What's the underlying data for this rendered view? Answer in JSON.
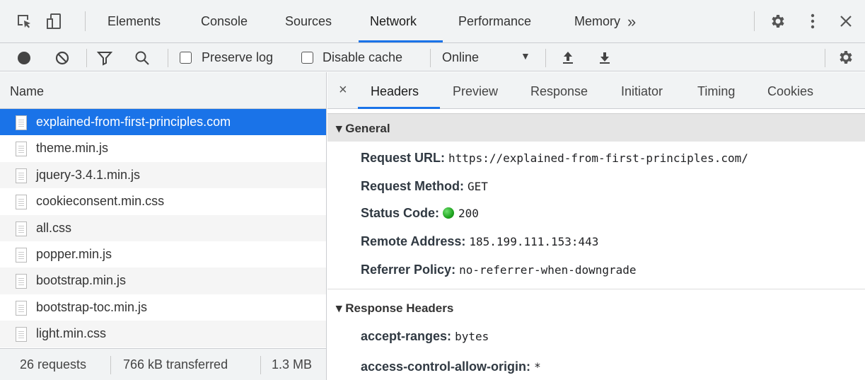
{
  "main_tabs": [
    {
      "label": "Elements"
    },
    {
      "label": "Console"
    },
    {
      "label": "Sources"
    },
    {
      "label": "Network",
      "active": true
    },
    {
      "label": "Performance"
    },
    {
      "label": "Memory"
    }
  ],
  "more_tabs": "»",
  "toolbar": {
    "preserve_log": "Preserve log",
    "disable_cache": "Disable cache",
    "throttling": "Online",
    "caret": "▼"
  },
  "requests": {
    "column_header": "Name",
    "items": [
      {
        "name": "explained-from-first-principles.com",
        "selected": true
      },
      {
        "name": "theme.min.js"
      },
      {
        "name": "jquery-3.4.1.min.js"
      },
      {
        "name": "cookieconsent.min.css"
      },
      {
        "name": "all.css"
      },
      {
        "name": "popper.min.js"
      },
      {
        "name": "bootstrap.min.js"
      },
      {
        "name": "bootstrap-toc.min.js"
      },
      {
        "name": "light.min.css"
      }
    ],
    "summary": {
      "requests": "26 requests",
      "transferred": "766 kB transferred",
      "size": "1.3 MB"
    }
  },
  "detail": {
    "close": "×",
    "tabs": [
      "Headers",
      "Preview",
      "Response",
      "Initiator",
      "Timing",
      "Cookies"
    ],
    "general": {
      "title": "▾ General",
      "request_url": {
        "key": "Request URL:",
        "value": "https://explained-from-first-principles.com/"
      },
      "request_method": {
        "key": "Request Method:",
        "value": "GET"
      },
      "status_code": {
        "key": "Status Code:",
        "value": "200"
      },
      "remote_address": {
        "key": "Remote Address:",
        "value": "185.199.111.153:443"
      },
      "referrer_policy": {
        "key": "Referrer Policy:",
        "value": "no-referrer-when-downgrade"
      }
    },
    "response_headers": {
      "title": "▾ Response Headers",
      "accept_ranges": {
        "key": "accept-ranges:",
        "value": "bytes"
      },
      "acao": {
        "key": "access-control-allow-origin:",
        "value": "*"
      }
    }
  },
  "colors": {
    "accent": "#1a73e8",
    "status_ok": "#1fa31f"
  }
}
